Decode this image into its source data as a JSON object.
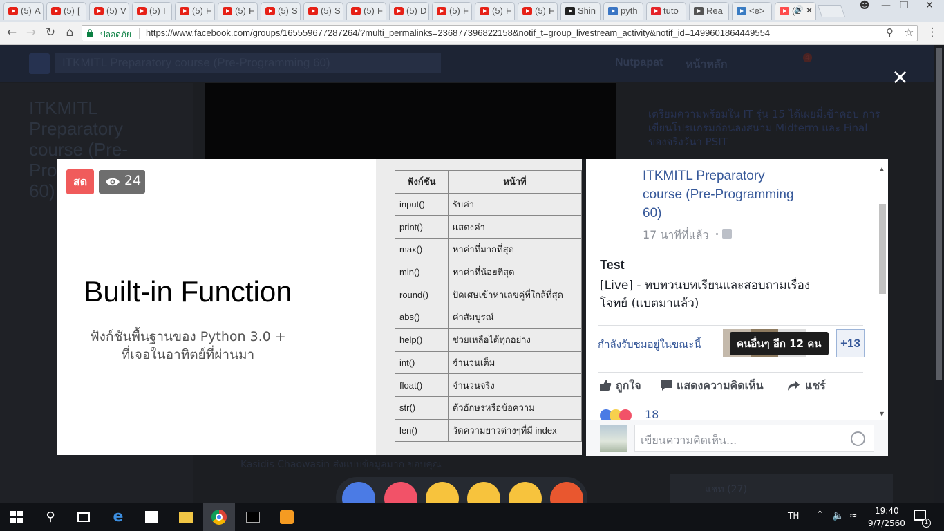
{
  "browser": {
    "tabs": [
      {
        "prefix": "(5)",
        "tail": "A",
        "type": "youtube"
      },
      {
        "prefix": "(5)",
        "tail": "[",
        "type": "youtube"
      },
      {
        "prefix": "(5)",
        "tail": "V",
        "type": "youtube"
      },
      {
        "prefix": "(5)",
        "tail": "I",
        "type": "youtube"
      },
      {
        "prefix": "(5)",
        "tail": "F",
        "type": "youtube"
      },
      {
        "prefix": "(5)",
        "tail": "F",
        "type": "youtube"
      },
      {
        "prefix": "(5)",
        "tail": "S",
        "type": "youtube"
      },
      {
        "prefix": "(5)",
        "tail": "S",
        "type": "youtube"
      },
      {
        "prefix": "(5)",
        "tail": "F",
        "type": "youtube"
      },
      {
        "prefix": "(5)",
        "tail": "D",
        "type": "youtube"
      },
      {
        "prefix": "(5)",
        "tail": "F",
        "type": "youtube"
      },
      {
        "prefix": "(5)",
        "tail": "F",
        "type": "youtube"
      },
      {
        "prefix": "(5)",
        "tail": "F",
        "type": "youtube"
      },
      {
        "prefix": "",
        "tail": "Shin",
        "type": "shin"
      },
      {
        "prefix": "",
        "tail": "pyth",
        "type": "python"
      },
      {
        "prefix": "",
        "tail": "tuto",
        "type": "pdf"
      },
      {
        "prefix": "",
        "tail": "Rea",
        "type": "read"
      },
      {
        "prefix": "",
        "tail": "<e>",
        "type": "code"
      },
      {
        "prefix": "",
        "tail": "(1",
        "type": "active"
      }
    ],
    "secure_label": "ปลอดภัย",
    "url": "https://www.facebook.com/groups/165559677287264/?multi_permalinks=236877396822158&notif_t=group_livestream_activity&notif_id=1499601864449554"
  },
  "facebook": {
    "search_text": "ITKMITL Preparatory course (Pre-Programming 60)",
    "user_name": "Nutpapat",
    "home_label": "หน้าหลัก",
    "notification_count": "4",
    "group_title": "ITKMITL Preparatory course (Pre-Programming 60)",
    "right_post": "เตรียมความพร้อมใน IT รุ่น 15 ได้เผยมี่เข้าคอบ การเขียนโปรแกรมก่อนลงสนาม Midterm และ Final ของจริงวันา PSIT",
    "bg_commenter": "Kasidis Chaowasin ส่งแบบข้อมูลมาก ขอบคุณ",
    "chat_label": "แชท (27)"
  },
  "live_video": {
    "live_badge": "สด",
    "viewer_count": "24",
    "slide_title": "Built-in Function",
    "slide_subtitle_line1": "ฟังก์ชันพื้นฐานของ Python 3.0 +",
    "slide_subtitle_line2": "ที่เจอในอาทิตย์ที่ผ่านมา",
    "table_headers": [
      "ฟังก์ชัน",
      "หน้าที่"
    ],
    "table_rows": [
      [
        "input()",
        "รับค่า"
      ],
      [
        "print()",
        "แสดงค่า"
      ],
      [
        "max()",
        "หาค่าที่มากที่สุด"
      ],
      [
        "min()",
        "หาค่าที่น้อยที่สุด"
      ],
      [
        "round()",
        "ปัดเศษเข้าหาเลขคู่ที่ใกล้ที่สุด"
      ],
      [
        "abs()",
        "ค่าสัมบูรณ์"
      ],
      [
        "help()",
        "ช่วยเหลือได้ทุกอย่าง"
      ],
      [
        "int()",
        "จำนวนเต็ม"
      ],
      [
        "float()",
        "จำนวนจริง"
      ],
      [
        "str()",
        "ตัวอักษรหรือข้อความ"
      ],
      [
        "len()",
        "วัดความยาวต่างๆที่มี index"
      ]
    ]
  },
  "post_panel": {
    "group_name_line1": "ITKMITL Preparatory",
    "group_name_line2": "course (Pre-Programming",
    "group_name_line3": "60)",
    "time_ago": "17 นาทีที่แล้ว",
    "post_title": "Test",
    "post_body_line1": "[Live] - ทบทวนบทเรียนและสอบถามเรื่อง",
    "post_body_line2": "โจทย์ (แบตมาแล้ว)",
    "watching_label": "กำลังรับชมอยู่ในขณะนี้",
    "tooltip": "คนอื่นๆ อีก 12 คน",
    "more_viewers": "+13",
    "like_label": "ถูกใจ",
    "comment_label": "แสดงความคิดเห็น",
    "share_label": "แชร์",
    "reaction_count": "18",
    "comment_placeholder": "เขียนความคิดเห็น..."
  },
  "close_symbol": "×",
  "taskbar": {
    "language": "TH",
    "time": "19:40",
    "date": "9/7/2560",
    "notification_badge": "1"
  },
  "colors": {
    "fb_blue": "#365899",
    "live_red": "#f05b5b",
    "taskbar": "#101216"
  }
}
